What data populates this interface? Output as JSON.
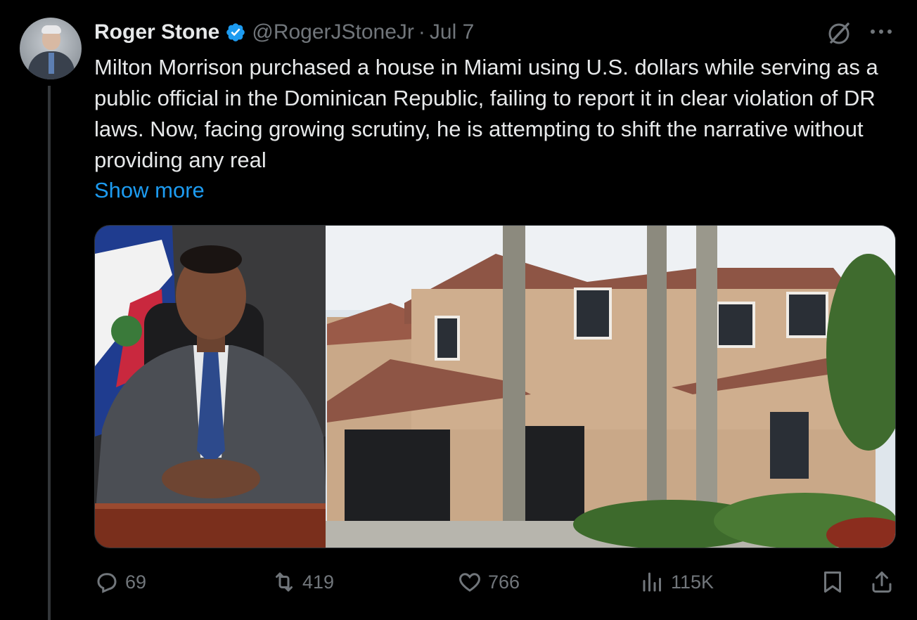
{
  "tweet": {
    "author_name": "Roger Stone",
    "handle": "@RogerJStoneJr",
    "separator": "·",
    "date": "Jul 7",
    "text": "Milton Morrison purchased a house in Miami using U.S. dollars while serving as a public official in the Dominican Republic, failing to report it in clear violation of DR laws. Now, facing growing scrutiny, he is attempting to shift the narrative without providing any real",
    "show_more": "Show more"
  },
  "actions": {
    "replies": "69",
    "reposts": "419",
    "likes": "766",
    "views": "115K"
  },
  "icons": {
    "verified": "verified-badge-icon",
    "grok": "grok-icon",
    "more": "more-icon",
    "reply": "reply-icon",
    "repost": "repost-icon",
    "like": "like-icon",
    "views": "views-icon",
    "bookmark": "bookmark-icon",
    "share": "share-icon"
  },
  "colors": {
    "background": "#000000",
    "text": "#e7e9ea",
    "muted": "#71767b",
    "link": "#1d9bf0"
  }
}
